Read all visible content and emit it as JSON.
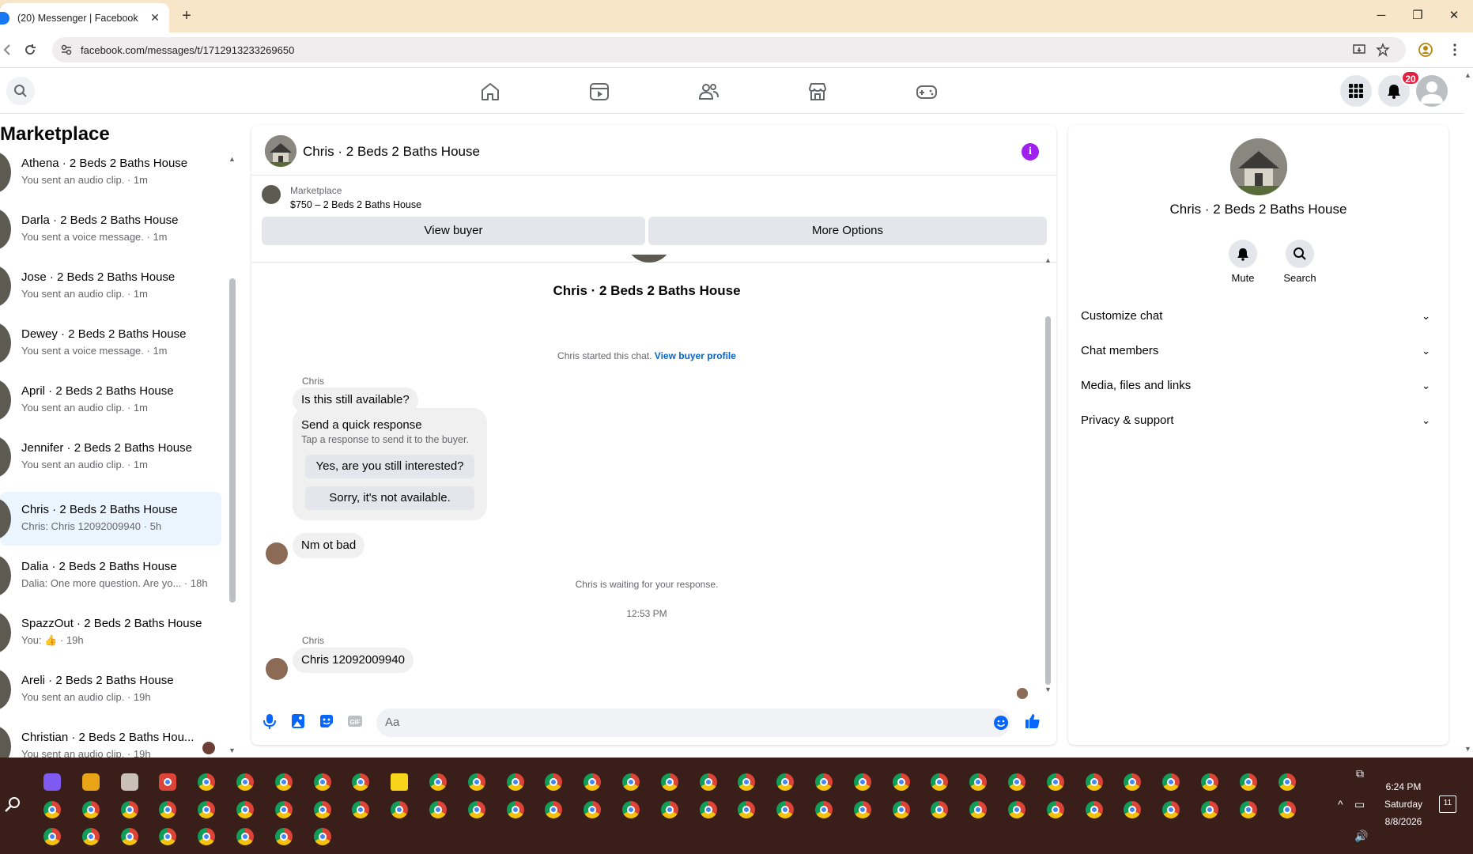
{
  "browser": {
    "tab_title": "(20) Messenger | Facebook",
    "tab_close": "✕",
    "new_tab": "+",
    "url": "facebook.com/messages/t/1712913233269650",
    "window_minimize": "─",
    "window_restore": "❐",
    "window_close": "✕"
  },
  "header": {
    "notification_count": "20"
  },
  "sidebar": {
    "title": "Marketplace",
    "conversations": [
      {
        "name": "Athena · 2 Beds 2 Baths House",
        "preview": "You sent an audio clip. · 1m"
      },
      {
        "name": "Darla · 2 Beds 2 Baths House",
        "preview": "You sent a voice message. · 1m"
      },
      {
        "name": "Jose · 2 Beds 2 Baths House",
        "preview": "You sent an audio clip. · 1m"
      },
      {
        "name": "Dewey · 2 Beds 2 Baths House",
        "preview": "You sent a voice message. · 1m"
      },
      {
        "name": "April · 2 Beds 2 Baths House",
        "preview": "You sent an audio clip. · 1m"
      },
      {
        "name": "Jennifer · 2 Beds 2 Baths House",
        "preview": "You sent an audio clip. · 1m"
      },
      {
        "name": "Chris · 2 Beds 2 Baths House",
        "preview": "Chris: Chris 12092009940 · 5h"
      },
      {
        "name": "Dalia · 2 Beds 2 Baths House",
        "preview": "Dalia: One more question. Are yo... · 18h"
      },
      {
        "name": "SpazzOut · 2 Beds 2 Baths House",
        "preview": "You: 👍 · 19h"
      },
      {
        "name": "Areli · 2 Beds 2 Baths House",
        "preview": "You sent an audio clip. · 19h"
      },
      {
        "name": "Christian · 2 Beds 2 Baths Hou...",
        "preview": "You sent an audio clip. · 19h"
      }
    ]
  },
  "chat": {
    "title": "Chris · 2 Beds 2 Baths House",
    "info_icon": "i",
    "marketplace_label": "Marketplace",
    "listing": "$750 – 2 Beds 2 Baths House",
    "view_buyer": "View buyer",
    "more_options": "More Options",
    "chat_name": "Chris · 2 Beds 2 Baths House",
    "started_text": "Chris started this chat.",
    "view_buyer_profile": "View buyer profile",
    "sender1": "Chris",
    "msg1": "Is this still available?",
    "quick_title": "Send a quick response",
    "quick_sub": "Tap a response to send it to the buyer.",
    "quick1": "Yes, are you still interested?",
    "quick2": "Sorry, it's not available.",
    "msg2": "Nm ot bad",
    "waiting": "Chris is waiting for your response.",
    "timestamp": "12:53 PM",
    "sender2": "Chris",
    "msg3": "Chris  12092009940",
    "composer_placeholder": "Aa"
  },
  "info_panel": {
    "title": "Chris · 2 Beds 2 Baths House",
    "mute": "Mute",
    "search": "Search",
    "sections": [
      "Customize chat",
      "Chat members",
      "Media, files and links",
      "Privacy & support"
    ]
  },
  "taskbar": {
    "time": "6:24 PM",
    "day": "Saturday",
    "date": "8/8/2026",
    "notif_count": "11"
  }
}
